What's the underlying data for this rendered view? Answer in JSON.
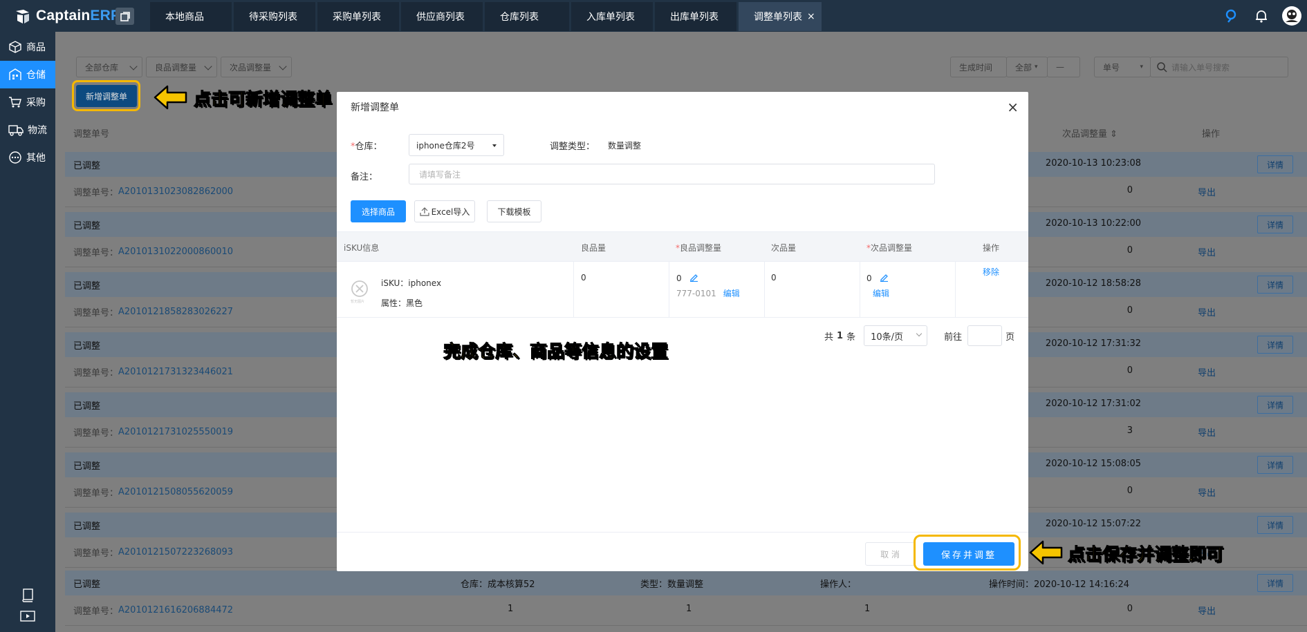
{
  "app": {
    "logo_prefix": "Captain",
    "logo_suffix": "ERP",
    "accent_color": "#1e90ff",
    "topbar_color": "#213345"
  },
  "tabs": [
    {
      "label": "本地商品"
    },
    {
      "label": "待采购列表"
    },
    {
      "label": "采购单列表"
    },
    {
      "label": "供应商列表"
    },
    {
      "label": "仓库列表"
    },
    {
      "label": "入库单列表"
    },
    {
      "label": "出库单列表"
    },
    {
      "label": "调整单列表",
      "active": true,
      "close": "×"
    }
  ],
  "top_icons": [
    "help-icon",
    "bell-icon",
    "user-avatar-icon"
  ],
  "sidebar": {
    "items": [
      {
        "label": "商品",
        "icon": "box-icon"
      },
      {
        "label": "仓储",
        "icon": "warehouse-icon",
        "active": true
      },
      {
        "label": "采购",
        "icon": "cart-icon"
      },
      {
        "label": "物流",
        "icon": "truck-icon"
      },
      {
        "label": "其他",
        "icon": "more-icon"
      }
    ],
    "bottom_icons": [
      "book-icon",
      "video-icon"
    ]
  },
  "filters": {
    "warehouse": "全部仓库",
    "good_adjust": "良品调整量",
    "bad_adjust": "次品调整量",
    "time_label": "生成时间",
    "time_range": "全部",
    "time_sep": "—",
    "search_type": "单号",
    "search_placeholder": "请输入单号搜索"
  },
  "new_button": "新增调整单",
  "list": {
    "header_no": "调整单号",
    "header_bad": "次品调整量",
    "header_op": "操作",
    "status": "已调整",
    "no_label": "调整单号：",
    "detail": "详情",
    "export": "导出",
    "rows": [
      {
        "time": "2020-10-13 10:23:08",
        "value": "0"
      },
      {
        "time": "2020-10-13 10:22:00",
        "value": "0"
      },
      {
        "time": "2020-10-12 18:58:28",
        "value": "0"
      },
      {
        "time": "2020-10-12 17:31:32",
        "value": "0"
      },
      {
        "time": "2020-10-12 17:31:02",
        "value": "3"
      },
      {
        "time": "2020-10-12 15:08:05",
        "value": "0"
      },
      {
        "time": "2020-10-12 15:07:22",
        "value": "0"
      }
    ],
    "last_row": {
      "warehouse": "仓库：成本核算52",
      "type": "类型：数量调整",
      "operator": "操作人：",
      "time": "操作时间：2020-10-12 14:16:24",
      "c1": "1",
      "c2": "1",
      "c3": "1",
      "value": "0"
    }
  },
  "annotations": {
    "new": "点击可新增调整单",
    "middle": "完成仓库、商品等信息的设置",
    "save": "点击保存并调整即可",
    "color": "#f5c400"
  },
  "modal": {
    "title": "新增调整单",
    "close": "×",
    "warehouse_label": "仓库：",
    "warehouse_required": "*",
    "warehouse_value": "iphone仓库2号",
    "type_label": "调整类型：",
    "type_value": "数量调整",
    "remark_label": "备注：",
    "remark_placeholder": "请填写备注",
    "choose_button": "选择商品",
    "excel_button": "Excel导入",
    "template_button": "下载模板",
    "table": {
      "headers": {
        "sku": "iSKU信息",
        "good_qty": "良品量",
        "good_adjust": "良品调整量",
        "bad_qty": "次品量",
        "bad_adjust": "次品调整量",
        "op": "操作"
      },
      "rows": [
        {
          "sku": "iSKU：iphonex",
          "attr": "属性：黑色",
          "thumb_text": "暂无图片",
          "good_qty": "0",
          "good_adjust": "0",
          "good_code": "777-0101",
          "bad_qty": "0",
          "bad_adjust": "0",
          "edit": "编辑",
          "remove": "移除"
        }
      ]
    },
    "pager": {
      "total_prefix": "共",
      "total": "1",
      "total_suffix": "条",
      "page_size": "10条/页",
      "goto_prefix": "前往",
      "goto_suffix": "页"
    },
    "cancel_button": "取 消",
    "save_button": "保存并调整"
  }
}
